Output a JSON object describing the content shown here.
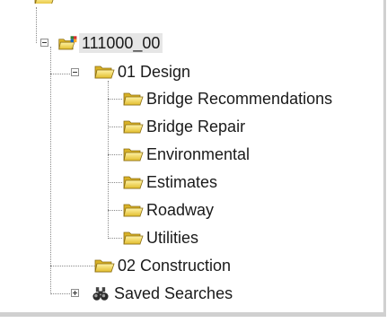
{
  "tree": {
    "root": {
      "label": "111000_00",
      "icon": "project-folder-icon",
      "expanded": true
    },
    "design": {
      "label": "01 Design",
      "icon": "folder-open-icon",
      "expanded": true,
      "children": [
        {
          "label": "Bridge Recommendations",
          "icon": "folder-icon"
        },
        {
          "label": "Bridge Repair",
          "icon": "folder-icon"
        },
        {
          "label": "Environmental",
          "icon": "folder-icon"
        },
        {
          "label": "Estimates",
          "icon": "folder-icon"
        },
        {
          "label": "Roadway",
          "icon": "folder-icon"
        },
        {
          "label": "Utilities",
          "icon": "folder-icon"
        }
      ]
    },
    "construction": {
      "label": "02 Construction",
      "icon": "folder-icon"
    },
    "saved_searches": {
      "label": "Saved Searches",
      "icon": "binoculars-icon",
      "expanded": false
    }
  },
  "colors": {
    "folder_light": "#f7e27a",
    "folder_dark": "#c9a11c",
    "folder_outline": "#8a6d12",
    "selection": "#e6e6e6",
    "tree_lines": "#8a8a8a"
  }
}
